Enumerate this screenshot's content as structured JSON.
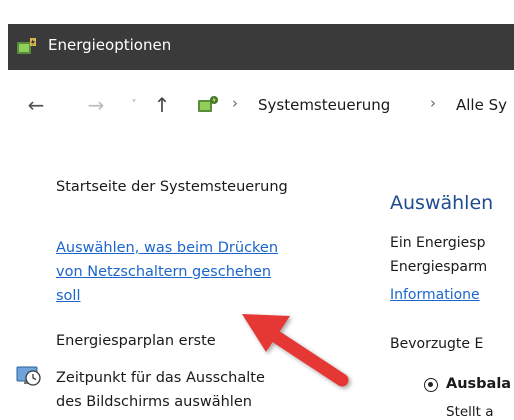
{
  "window": {
    "title": "Energieoptionen",
    "icon": "power-options-icon"
  },
  "navigation": {
    "back": "←",
    "forward": "→",
    "recent": "˅",
    "up": "↑",
    "separator": "›",
    "breadcrumbs": [
      "Systemsteuerung",
      "Alle Sy"
    ]
  },
  "sidebar": {
    "home_link": "Startseite der Systemsteuerung",
    "power_button_link": [
      "Auswählen, was beim Drücken",
      "von Netzschaltern geschehen",
      "soll"
    ],
    "create_plan_link": "Energiesparplan erste",
    "display_off_link": [
      "Zeitpunkt für das Ausschalte",
      "des Bildschirms auswählen"
    ]
  },
  "main": {
    "heading": "Auswählen",
    "desc_lines": [
      "Ein Energiesp",
      "Energiesparm"
    ],
    "info_link": "Informatione",
    "preferred_label": "Bevorzugte E",
    "plan_name": "Ausbala",
    "plan_desc": "Stellt a"
  },
  "colors": {
    "titlebar": "#3a3a3a",
    "link": "#1a66cc",
    "heading": "#1e4c8f",
    "annotation_arrow": "#e53935"
  }
}
